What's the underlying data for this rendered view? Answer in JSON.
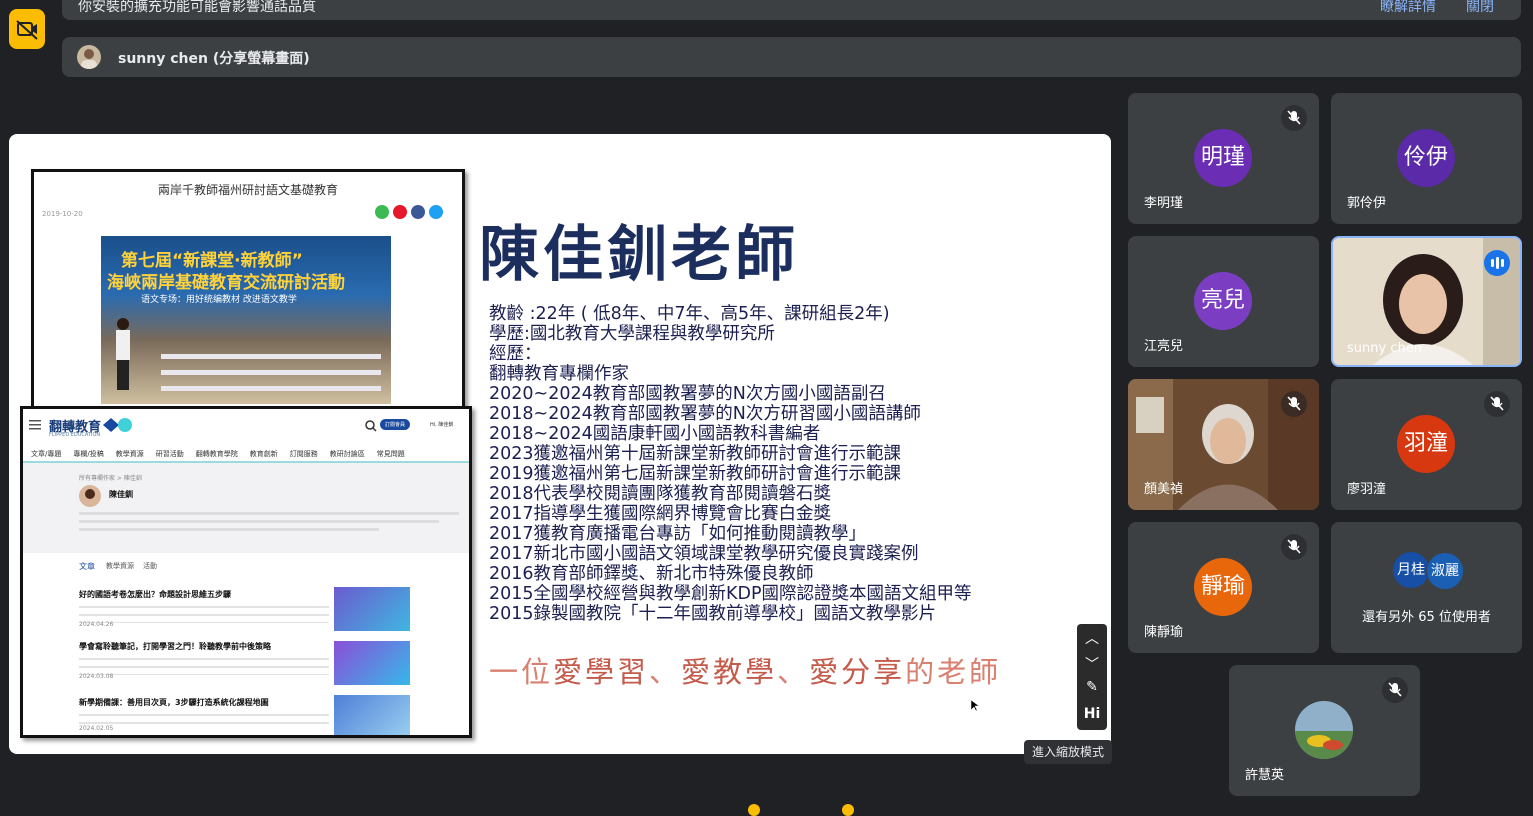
{
  "notices": {
    "warning_text": "你安裝的擴充功能可能會影響通話品質",
    "details_link": "瞭解詳情",
    "close_link": "關閉",
    "presenter_label": "sunny chen (分享螢幕畫面)"
  },
  "slide": {
    "teacher_name": "陳佳釧老師",
    "bio_lines": [
      "教齡 :22年 ( 低8年、中7年、高5年、課研組長2年)",
      "學歷:國北教育大學課程與教學研究所",
      "經歷：",
      "翻轉教育專欄作家",
      "2020~2024教育部國教署夢的N次方國小國語副召",
      "2018~2024教育部國教署夢的N次方研習國小國語講師",
      "2018~2024國語康軒國小國語教科書編者",
      "2023獲邀福州第十屆新課堂新教師研討會進行示範課",
      "2019獲邀福州第七屆新課堂新教師研討會進行示範課",
      "2018代表學校閱讀團隊獲教育部閱讀磐石獎",
      "2017指導學生獲國際網界博覽會比賽白金獎",
      "2017獲教育廣播電台專訪「如何推動閱讀教學」",
      "2017新北市國小國語文領域課堂教學研究優良實踐案例",
      "2016教育部師鐸獎、新北市特殊優良教師",
      "2015全國學校經營與教學創新KDP國際認證獎本國語文組甲等",
      "2015錄製國教院「十二年國教前導學校」國語文教學影片"
    ],
    "motto_pre": "一位",
    "motto_a": "愛學習",
    "motto_sep1": "、",
    "motto_b": "愛教學",
    "motto_sep2": "、",
    "motto_c": "愛分享",
    "motto_post": "的老師",
    "article1": {
      "title": "兩岸千教師福州研討語文基礎教育",
      "date": "2019-10-20",
      "banner_line1": "第七屆“新課堂·新教師”",
      "banner_line2": "海峽兩岸基礎教育交流研討活動",
      "banner_line3": "语文专场：用好统编教材 改进语文教学"
    },
    "article2": {
      "logo": "翻轉教育",
      "logo_sub": "FLIPPED EDUCATION",
      "search_button": "訂閱會員",
      "user_greeting": "Hi, 陳佳釧",
      "nav": [
        "文章/專題",
        "專欄/投稿",
        "教學資源",
        "研習活動",
        "翻轉教育學院",
        "教育創新",
        "訂閱服務",
        "教研討論區",
        "常見問題"
      ],
      "breadcrumb": "所有專欄作家 > 陳佳釧",
      "author": "陳佳釧",
      "tabs": [
        "文章",
        "教學資源",
        "活動"
      ],
      "posts": [
        {
          "title": "好的國語考卷怎麼出？命題設計思維五步驟",
          "date": "2024.04.26"
        },
        {
          "title": "學會寫聆聽筆記，打開學習之門！聆聽教學前中後策略",
          "date": "2024.03.08"
        },
        {
          "title": "新學期備課：善用目次頁，3步驟打造系統化課程地圖",
          "date": "2024.02.05"
        }
      ]
    }
  },
  "slide_tools": {
    "up": "︿",
    "down": "﹀",
    "pen": "✎",
    "hi": "Hi"
  },
  "zoom_tooltip": "進入縮放模式",
  "participants": [
    {
      "name": "李明瑾",
      "initials": "明瑾",
      "color": "#6a2db3"
    },
    {
      "name": "郭伶伊",
      "initials": "伶伊",
      "color": "#5b2aa8"
    },
    {
      "name": "江亮兒",
      "initials": "亮兒",
      "color": "#7b3ec2"
    },
    {
      "name": "sunny chen"
    },
    {
      "name": "顏美禎"
    },
    {
      "name": "廖羽潼",
      "initials": "羽潼",
      "color": "#d7380f"
    },
    {
      "name": "陳靜瑜",
      "initials": "靜瑜",
      "color": "#e8670b"
    },
    {
      "name": "許慧英"
    }
  ],
  "others": {
    "avatar_a": "月桂",
    "avatar_b": "淑麗",
    "label": "還有另外 65 位使用者"
  }
}
